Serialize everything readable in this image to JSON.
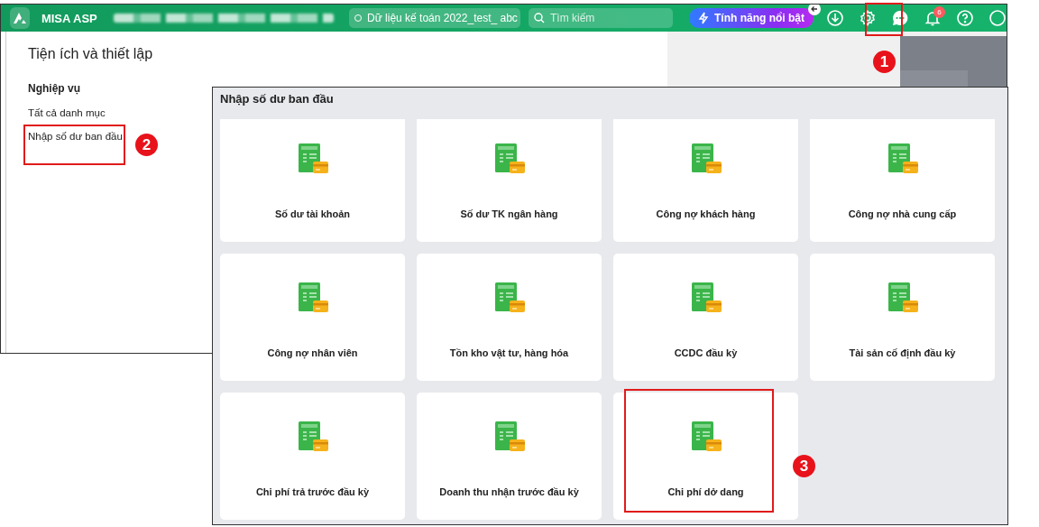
{
  "app_header": {
    "brand": "MISA ASP",
    "database": "Dữ liệu kế toán 2022_test_ abc",
    "search": {
      "placeholder": "Tìm kiếm"
    },
    "feature_button": "Tính năng nổi bật",
    "notification_count": "6"
  },
  "settings_page": {
    "title": "Tiện ích và thiết lập",
    "section": "Nghiệp vụ",
    "items": [
      {
        "label": "Tất cả danh mục"
      },
      {
        "label": "Nhập số dư ban đầu"
      }
    ]
  },
  "opening_balance_panel": {
    "title": "Nhập số dư ban đầu",
    "cards": [
      {
        "label": "Số dư tài khoản"
      },
      {
        "label": "Số dư TK ngân hàng"
      },
      {
        "label": "Công nợ khách hàng"
      },
      {
        "label": "Công nợ nhà cung cấp"
      },
      {
        "label": "Công nợ nhân viên"
      },
      {
        "label": "Tồn kho vật tư, hàng hóa"
      },
      {
        "label": "CCDC đầu kỳ"
      },
      {
        "label": "Tài sản cố định đầu kỳ"
      },
      {
        "label": "Chi phí trả trước đầu kỳ"
      },
      {
        "label": "Doanh thu nhận trước đầu kỳ"
      },
      {
        "label": "Chi phí dở dang"
      }
    ]
  },
  "annotations": [
    "1",
    "2",
    "3"
  ]
}
